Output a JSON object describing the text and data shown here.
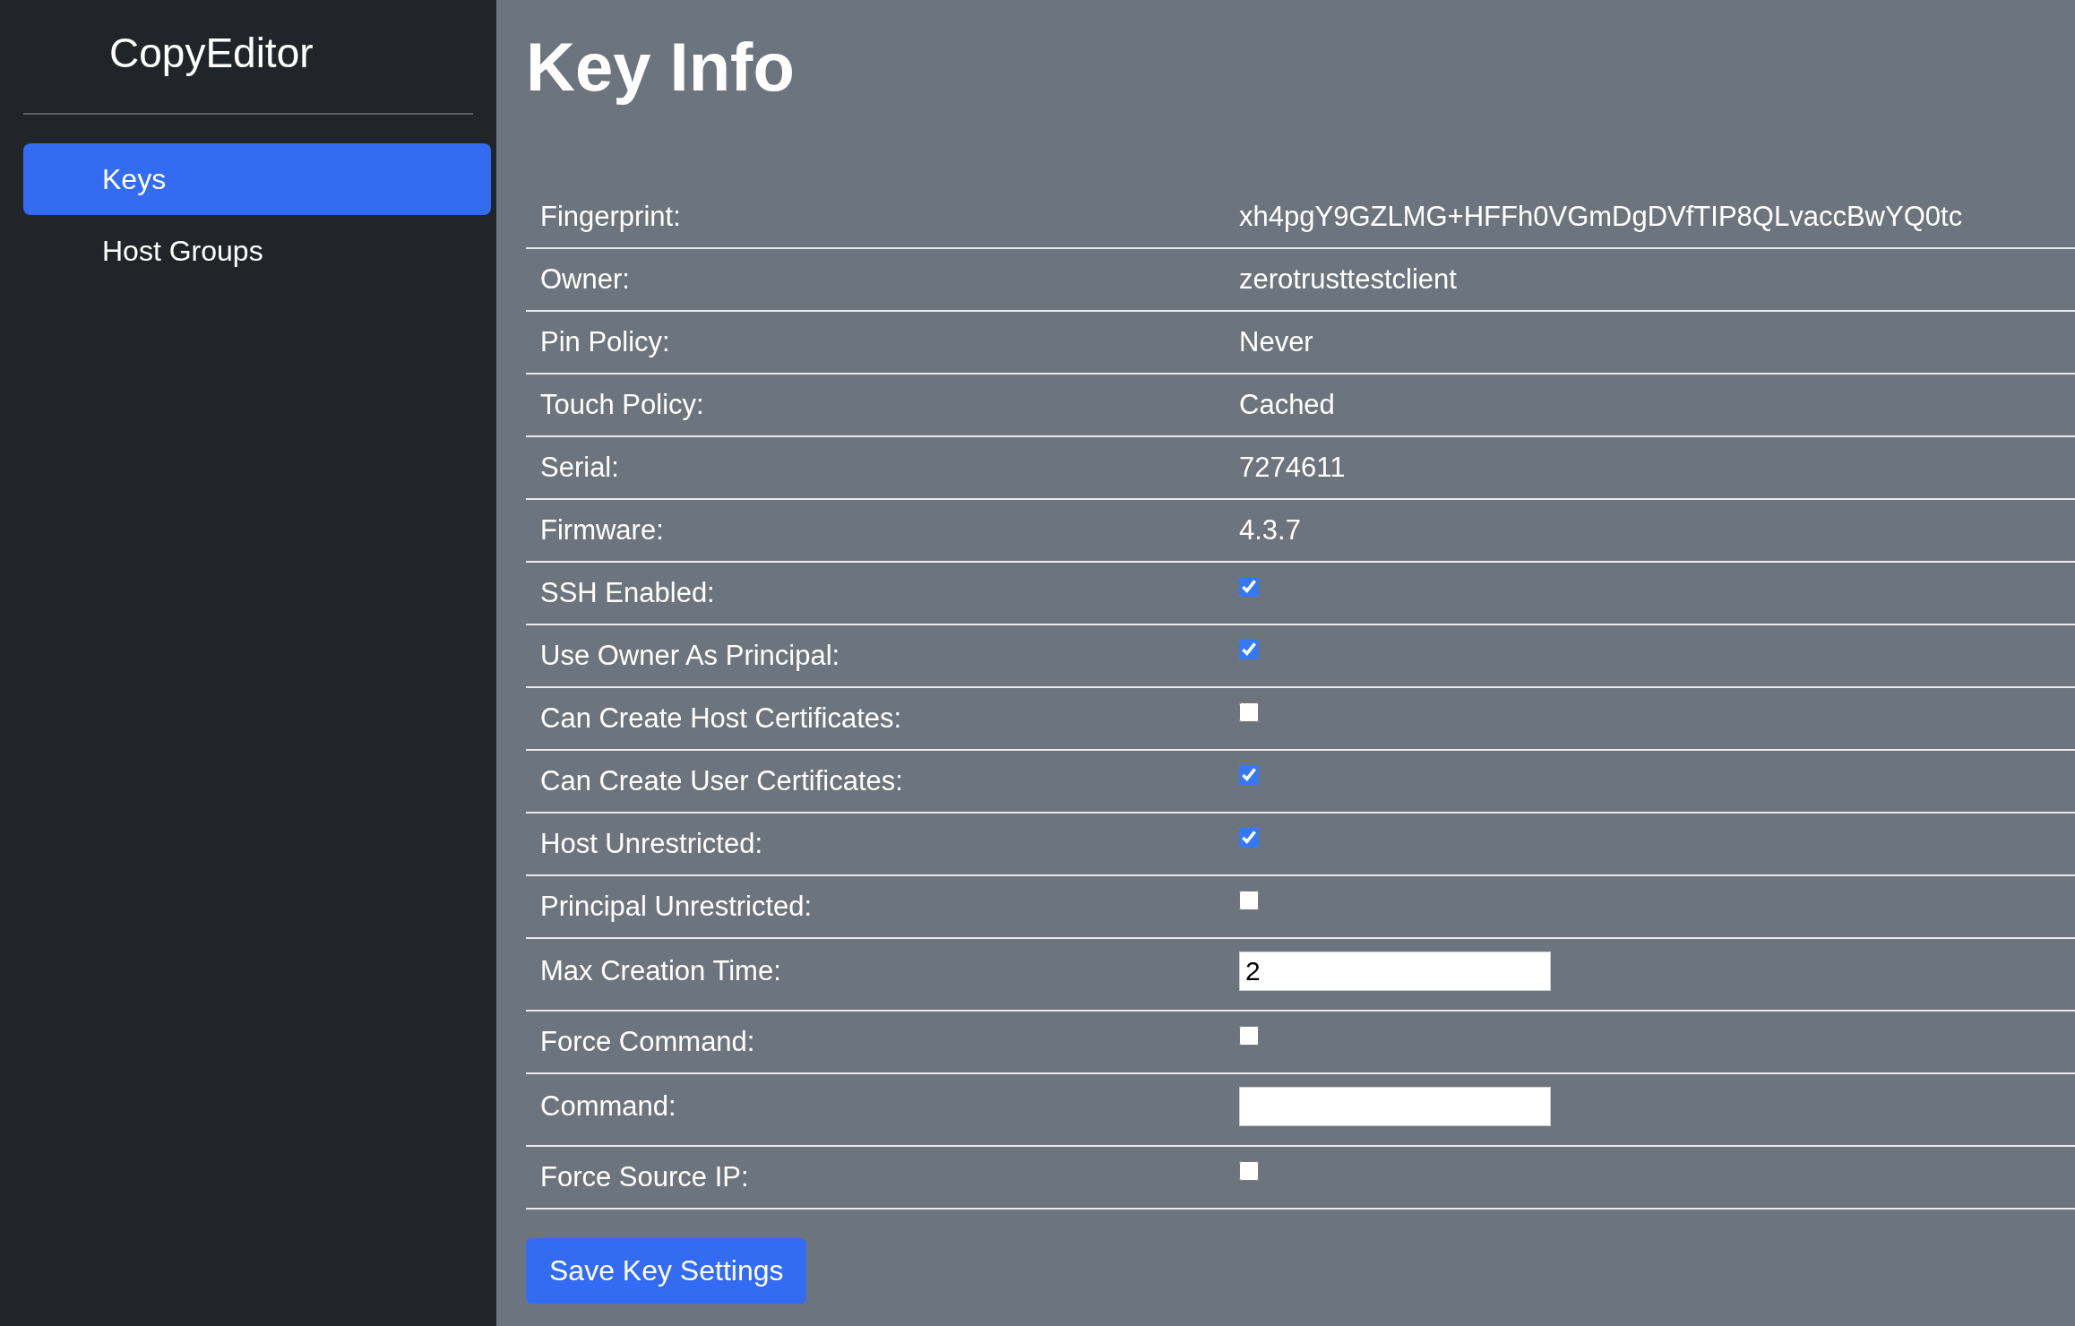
{
  "sidebar": {
    "brand": "CopyEditor",
    "items": [
      {
        "label": "Keys",
        "selected": true
      },
      {
        "label": "Host Groups",
        "selected": false
      }
    ]
  },
  "page": {
    "title": "Key Info"
  },
  "fields": [
    {
      "label": "Fingerprint:",
      "kind": "text",
      "value": "xh4pgY9GZLMG+HFFh0VGmDgDVfTIP8QLvaccBwYQ0tc"
    },
    {
      "label": "Owner:",
      "kind": "text",
      "value": "zerotrusttestclient"
    },
    {
      "label": "Pin Policy:",
      "kind": "text",
      "value": "Never"
    },
    {
      "label": "Touch Policy:",
      "kind": "text",
      "value": "Cached"
    },
    {
      "label": "Serial:",
      "kind": "text",
      "value": "7274611"
    },
    {
      "label": "Firmware:",
      "kind": "text",
      "value": "4.3.7"
    },
    {
      "label": "SSH Enabled:",
      "kind": "checkbox",
      "checked": true
    },
    {
      "label": "Use Owner As Principal:",
      "kind": "checkbox",
      "checked": true
    },
    {
      "label": "Can Create Host Certificates:",
      "kind": "checkbox",
      "checked": false
    },
    {
      "label": "Can Create User Certificates:",
      "kind": "checkbox",
      "checked": true
    },
    {
      "label": "Host Unrestricted:",
      "kind": "checkbox",
      "checked": true
    },
    {
      "label": "Principal Unrestricted:",
      "kind": "checkbox",
      "checked": false
    },
    {
      "label": "Max Creation Time:",
      "kind": "input",
      "value": "2"
    },
    {
      "label": "Force Command:",
      "kind": "checkbox",
      "checked": false
    },
    {
      "label": "Command:",
      "kind": "input"
    },
    {
      "label": "Force Source IP:",
      "kind": "checkbox",
      "checked": false
    }
  ],
  "save_button": "Save Key Settings"
}
